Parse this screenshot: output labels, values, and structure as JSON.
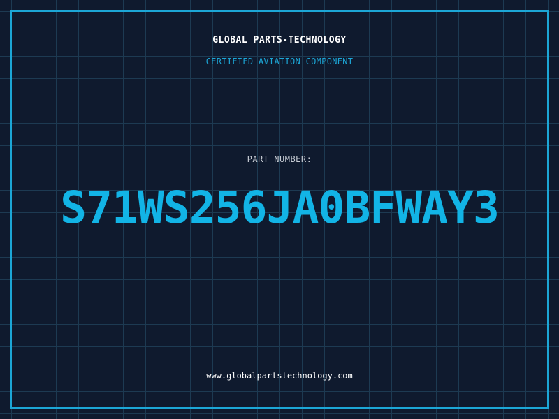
{
  "header": {
    "company_name": "GLOBAL PARTS-TECHNOLOGY",
    "subtitle": "CERTIFIED AVIATION COMPONENT"
  },
  "part": {
    "label": "PART NUMBER:",
    "number": "S71WS256JA0BFWAY3"
  },
  "footer": {
    "website": "www.globalpartstechnology.com"
  },
  "colors": {
    "background": "#0f1a2e",
    "grid": "#1d3a52",
    "accent": "#1ca6d6",
    "text": "#ffffff"
  }
}
